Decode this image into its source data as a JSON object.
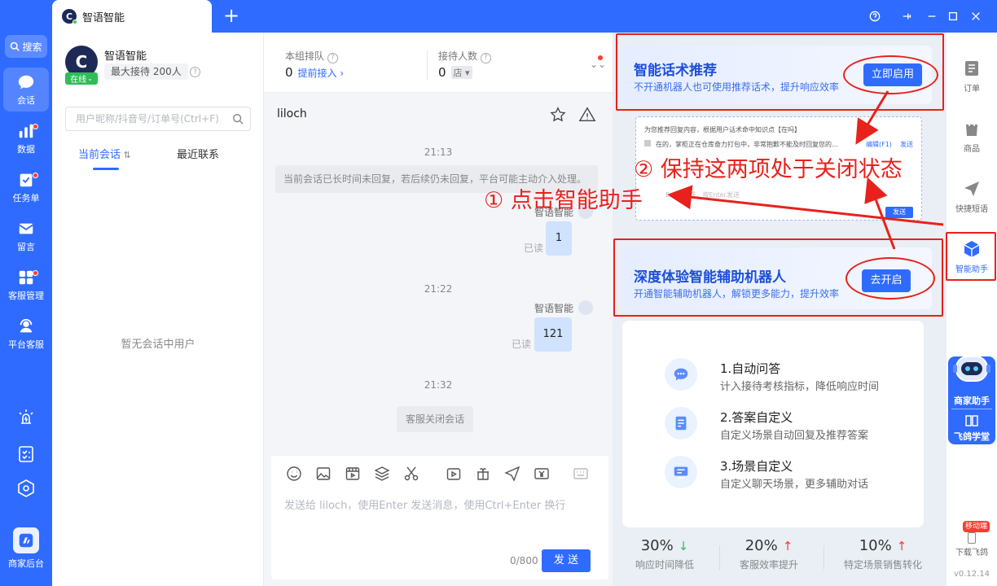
{
  "tab": {
    "title": "智语智能"
  },
  "leftnav": {
    "search": "搜索",
    "items": [
      {
        "label": "会话",
        "icon": "chat-icon",
        "badge": false
      },
      {
        "label": "数据",
        "icon": "bar-chart-icon",
        "badge": true
      },
      {
        "label": "任务单",
        "icon": "task-icon",
        "badge": true
      },
      {
        "label": "留言",
        "icon": "mail-icon",
        "badge": false
      },
      {
        "label": "客服管理",
        "icon": "grid-icon",
        "badge": true
      },
      {
        "label": "平台客服",
        "icon": "headset-icon",
        "badge": false
      }
    ],
    "bottom_label": "商家后台"
  },
  "contacts": {
    "shop_name": "智语智能",
    "status": "在线",
    "max_reception": "最大接待 200人",
    "search_placeholder": "用户昵称/抖音号/订单号(Ctrl+F)",
    "tab_current": "当前会话",
    "tab_recent": "最近联系",
    "empty": "暂无会话中用户"
  },
  "stats": {
    "queue_label": "本组排队",
    "queue_value": "0",
    "queue_link": "提前接入",
    "recv_label": "接待人数",
    "recv_value": "0",
    "recv_tag": "店"
  },
  "chat": {
    "user": "liloch",
    "messages": [
      {
        "time": "21:13",
        "system": "当前会话已长时间未回复，若后续仍未回复，平台可能主动介入处理。"
      },
      {
        "sender": "智语智能",
        "text": "1",
        "read": "已读"
      },
      {
        "time": "21:22",
        "sender": "智语智能",
        "text": "121",
        "read": "已读"
      },
      {
        "time": "21:32",
        "system": "客服关闭会话"
      }
    ],
    "compose_placeholder": "发送给 liloch，使用Enter 发送消息，使用Ctrl+Enter 换行",
    "count": "0/800",
    "send": "发 送"
  },
  "assistant": {
    "card1": {
      "title": "智能话术推荐",
      "subtitle": "不开通机器人也可使用推荐话术，提升响应效率",
      "button": "立即启用"
    },
    "preview": {
      "line1": "为您推荐回复内容，根据用户话术命中知识点【在吗】",
      "line2": "在的，掌柜正在仓库奋力打包中，非常抱歉不能及时回复您的…",
      "edit": "编辑(F1)",
      "send": "发送",
      "input_hint": "Enter发送，按Enter发送",
      "send_btn": "发送"
    },
    "card2": {
      "title": "深度体验智能辅助机器人",
      "subtitle": "开通智能辅助机器人，解锁更多能力，提升效率",
      "button": "去开启"
    },
    "features": [
      {
        "title": "1.自动问答",
        "desc": "计入接待考核指标，降低响应时间"
      },
      {
        "title": "2.答案自定义",
        "desc": "自定义场景自动回复及推荐答案"
      },
      {
        "title": "3.场景自定义",
        "desc": "自定义聊天场景，更多辅助对话"
      }
    ],
    "metrics": [
      {
        "value": "30%",
        "dir": "down",
        "label": "响应时间降低"
      },
      {
        "value": "20%",
        "dir": "up",
        "label": "客服效率提升"
      },
      {
        "value": "10%",
        "dir": "up",
        "label": "特定场景销售转化"
      }
    ]
  },
  "rightbar": {
    "items": [
      "订单",
      "商品",
      "快捷短语",
      "智能助手"
    ],
    "merchant_assistant": "商家助手",
    "feige_academy": "飞鸽学堂",
    "mobile_badge": "移动端",
    "download": "下载飞鸽",
    "version": "v0.12.14"
  },
  "annotations": {
    "step1": "① 点击智能助手",
    "step2": "② 保持这两项处于关闭状态"
  },
  "colors": {
    "brand": "#2f6bff",
    "annotation": "#e8211c",
    "online": "#2ebd59"
  }
}
